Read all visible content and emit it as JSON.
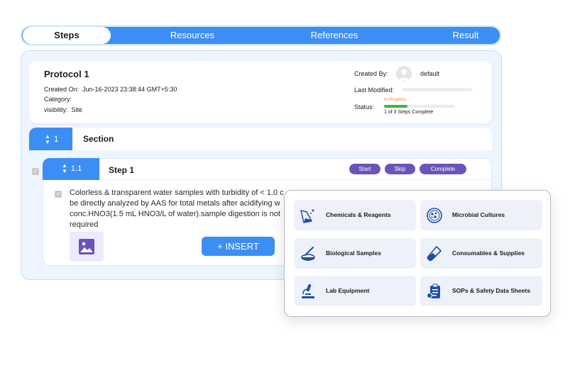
{
  "tabs": [
    {
      "label": "Steps",
      "active": true
    },
    {
      "label": "Resources",
      "active": false
    },
    {
      "label": "References",
      "active": false
    },
    {
      "label": "Result",
      "active": false
    }
  ],
  "protocol": {
    "title": "Protocol 1",
    "created_on_label": "Created On:",
    "created_on_value": "Jun-16-2023 23:38:44 GMT+5:30",
    "category_label": "Category:",
    "category_value": "",
    "visibility_label": "visibility:",
    "visibility_value": "Site",
    "created_by_label": "Created By:",
    "created_by_value": "default",
    "last_modified_label": "Last Modified:",
    "status_label": "Status:",
    "status_value": "In-Progress",
    "steps_complete": "1 of 3 Steps Complete",
    "progress_fraction": 0.3333
  },
  "section": {
    "number": "1",
    "title": "Section"
  },
  "step": {
    "number": "1.1",
    "title": "Step 1",
    "start_label": "Start",
    "skip_label": "Skip",
    "complete_label": "Complete",
    "description": "Colorless & transparent water samples with turbidity of < 1.0 c be directly analyzed by AAS for total metals after acidifying w conc.HNO3(1.5 mL HNO3/L of water).sample digestion is not required",
    "insert_label": "+ INSERT"
  },
  "resources": [
    {
      "label": "Chemicals & Reagents",
      "icon": "flask-icon"
    },
    {
      "label": "Microbial Cultures",
      "icon": "petri-dish-icon"
    },
    {
      "label": "Biological Samples",
      "icon": "sample-dish-icon"
    },
    {
      "label": "Consumables & Supplies",
      "icon": "test-tube-icon"
    },
    {
      "label": "Lab Equipment",
      "icon": "microscope-icon"
    },
    {
      "label": "SOPs & Safety Data Sheets",
      "icon": "clipboard-icon"
    }
  ],
  "colors": {
    "accent": "#3d8ef4",
    "action_pill": "#6b54b8",
    "progress": "#3bb54a",
    "status": "#e0912a",
    "icon": "#1f4fa8"
  }
}
